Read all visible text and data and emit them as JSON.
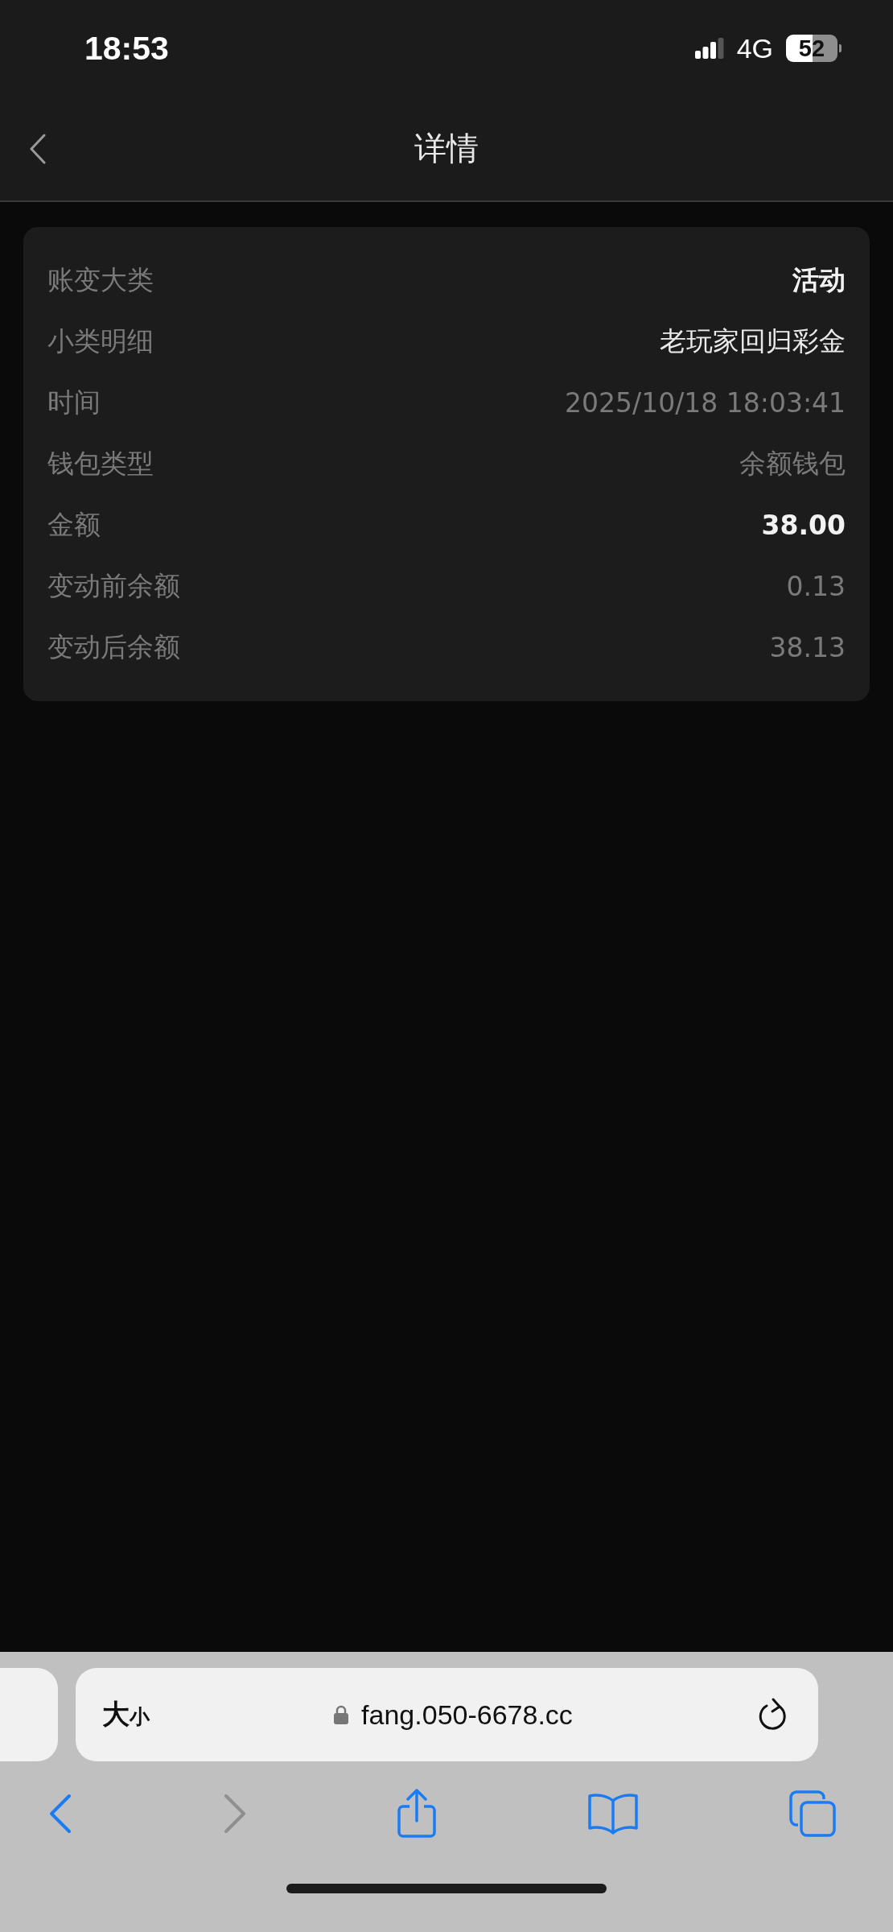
{
  "status_bar": {
    "time": "18:53",
    "network": "4G",
    "battery": "52"
  },
  "nav_bar": {
    "title": "详情"
  },
  "details": [
    {
      "label": "账变大类",
      "value": "活动",
      "kind": "strong"
    },
    {
      "label": "小类明细",
      "value": "老玩家回归彩金",
      "kind": "normal"
    },
    {
      "label": "时间",
      "value": "2025/10/18 18:03:41",
      "kind": "muted"
    },
    {
      "label": "钱包类型",
      "value": "余额钱包",
      "kind": "muted"
    },
    {
      "label": "金额",
      "value": "38.00",
      "kind": "strong"
    },
    {
      "label": "变动前余额",
      "value": "0.13",
      "kind": "muted"
    },
    {
      "label": "变动后余额",
      "value": "38.13",
      "kind": "muted"
    }
  ],
  "browser": {
    "text_size_big": "大",
    "text_size_small": "小",
    "url": "fang.050-6678.cc",
    "toolbar": [
      {
        "kind": "back",
        "disabled": false
      },
      {
        "kind": "forward",
        "disabled": true
      },
      {
        "kind": "share",
        "disabled": false
      },
      {
        "kind": "bookmarks",
        "disabled": false
      },
      {
        "kind": "tabs",
        "disabled": false
      }
    ]
  }
}
